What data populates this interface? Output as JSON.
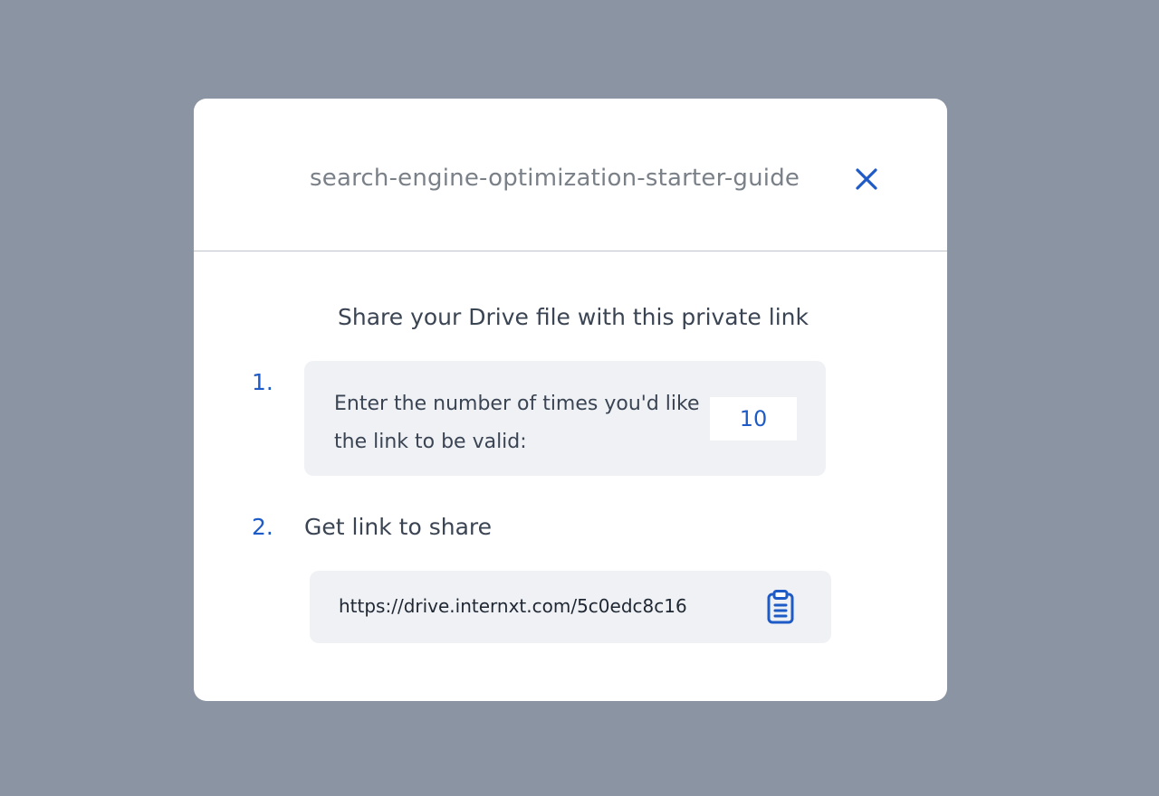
{
  "modal": {
    "file_name": "search-engine-optimization-starter-guide",
    "title": "Share your Drive file with this private link"
  },
  "step1": {
    "number": "1.",
    "text": "Enter the number of times you'd like the link to be valid:",
    "uses_value": "10"
  },
  "step2": {
    "number": "2.",
    "label": "Get link to share",
    "link": "https://drive.internxt.com/5c0edc8c16"
  },
  "icons": {
    "close": "close-icon",
    "copy": "clipboard-icon"
  },
  "colors": {
    "accent": "#1e5bc6",
    "backdrop": "#8a94a2",
    "panel": "#eff1f5",
    "text": "#3a4453"
  }
}
